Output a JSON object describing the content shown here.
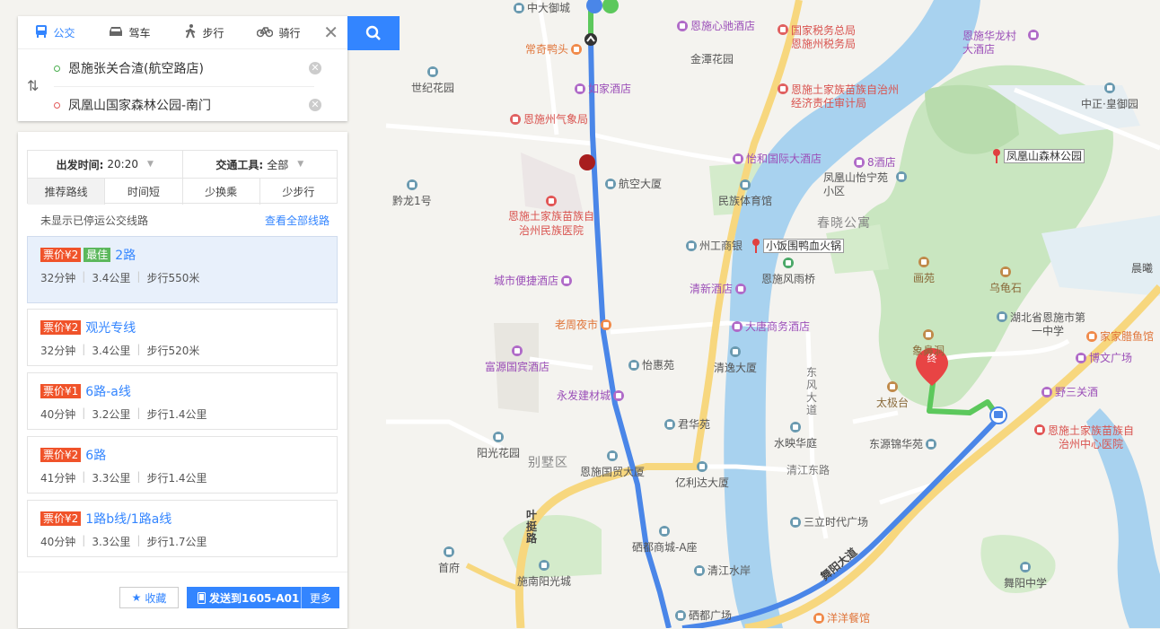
{
  "modes": [
    {
      "label": "公交",
      "icon": "bus-icon",
      "glyph": "🚌"
    },
    {
      "label": "驾车",
      "icon": "car-icon",
      "glyph": "🚗"
    },
    {
      "label": "步行",
      "icon": "walk-icon",
      "glyph": "🚶"
    },
    {
      "label": "骑行",
      "icon": "bike-icon",
      "glyph": "🚲"
    }
  ],
  "origin": "恩施张关合渣(航空路店)",
  "destination": "凤凰山国家森林公园-南门",
  "filters": {
    "depart_label": "出发时间:",
    "depart_value": "20:20",
    "vehicle_label": "交通工具:",
    "vehicle_value": "全部",
    "tabs": [
      "推荐路线",
      "时间短",
      "少换乘",
      "少步行"
    ]
  },
  "notice": "未显示已停运公交线路",
  "show_all": "查看全部线路",
  "routes": [
    {
      "fare": "票价¥2",
      "best": "最佳",
      "name": "2路",
      "time": "32分钟",
      "dist": "3.4公里",
      "walk": "步行550米"
    },
    {
      "fare": "票价¥2",
      "best": "",
      "name": "观光专线",
      "time": "32分钟",
      "dist": "3.4公里",
      "walk": "步行520米"
    },
    {
      "fare": "票价¥1",
      "best": "",
      "name": "6路-a线",
      "time": "40分钟",
      "dist": "3.2公里",
      "walk": "步行1.4公里"
    },
    {
      "fare": "票价¥2",
      "best": "",
      "name": "6路",
      "time": "41分钟",
      "dist": "3.3公里",
      "walk": "步行1.4公里"
    },
    {
      "fare": "票价¥2",
      "best": "",
      "name": "1路b线/1路a线",
      "time": "40分钟",
      "dist": "3.3公里",
      "walk": "步行1.7公里"
    }
  ],
  "actions": {
    "favorite": "收藏",
    "send": "发送到1605-A01",
    "more": "更多"
  },
  "map": {
    "areas": [
      "春晓公寓",
      "别墅区"
    ],
    "roads": [
      "东风大道",
      "清江东路",
      "叶挺路",
      "舞阳大道"
    ],
    "pins": [
      "凤凰山森林公园",
      "小饭围鸭血火锅"
    ],
    "end_marker": "终",
    "pois": {
      "zhongda": "中大御城",
      "enshixinchi": "恩施心驰酒店",
      "shuiwu": "国家税务总局恩施州税务局",
      "changqi": "常奇鸭头",
      "jintan": "金潭花园",
      "huafen": "恩施华龙村大酒店",
      "shiji": "世纪花园",
      "rujia": "如家酒店",
      "jingji": "恩施土家族苗族自治州经济责任审计局",
      "zhongzheng": "中正·皇御园",
      "qixiang": "恩施州气象局",
      "yihe": "怡和国际大酒店",
      "jiu": "8酒店",
      "hangkong": "航空大厦",
      "fenghuangshan": "凤凰山怡宁苑小区",
      "qianlong": "黔龙1号",
      "minzuyiyuan": "恩施土家族苗族自治州民族医院",
      "minzutiyu": "民族体育馆",
      "gongshang": "州工商银",
      "fengyuqiao": "恩施风雨桥",
      "chengshi": "城市便捷酒店",
      "qingxin": "清新酒店",
      "huayuan": "画苑",
      "wuguishi": "乌龟石",
      "laozhou": "老周夜市",
      "datang": "大唐商务酒店",
      "yizhong": "湖北省恩施市第一中学",
      "jiajia": "家家腊鱼馆",
      "fuyuan": "富源国宾酒店",
      "yihui": "怡惠苑",
      "qingyi": "清逸大厦",
      "bowen": "博文广场",
      "yongfa": "永发建材城",
      "xiangbi": "象鼻洞",
      "taiji": "太极台",
      "yesanguan": "野三关酒",
      "junhua": "君华苑",
      "yangguang": "阳光花园",
      "shuiying": "水映华庭",
      "dongyuan": "东源锦华苑",
      "zhongxin": "恩施土家族苗族自治州中心医院",
      "guomao": "恩施国贸大厦",
      "yilida": "亿利达大厦",
      "sanli": "三立时代广场",
      "shangcheng": "硒都商城-A座",
      "shoufu": "首府",
      "qingjiang": "清江水岸",
      "wuyang": "舞阳中学",
      "shinan": "施南阳光城",
      "xiduguangchang": "硒都广场",
      "yangyang": "洋洋餐馆",
      "chenlan": "晨曦"
    }
  }
}
